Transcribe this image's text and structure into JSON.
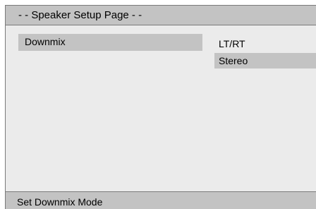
{
  "window": {
    "title": "- - Speaker Setup Page - -"
  },
  "menu": {
    "items": [
      {
        "label": "Downmix",
        "highlighted": true
      }
    ]
  },
  "options": {
    "items": [
      {
        "label": "LT/RT",
        "selected": false
      },
      {
        "label": "Stereo",
        "selected": true
      }
    ]
  },
  "status": {
    "text": "Set Downmix Mode"
  },
  "colors": {
    "panel_background": "#ebebeb",
    "highlight": "#c3c3c3",
    "border": "#7a7a7a",
    "text": "#000000"
  }
}
